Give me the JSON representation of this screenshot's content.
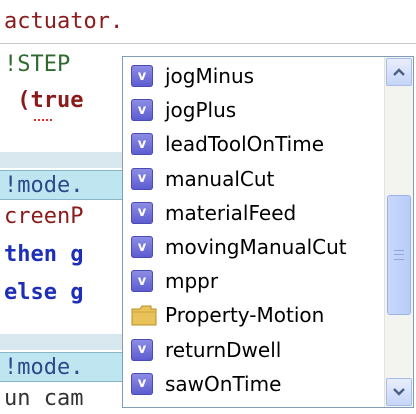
{
  "editor": {
    "lines": [
      "actuator.",
      "!STEP",
      " (true",
      "!mode.",
      "creenP",
      "then g",
      "else g",
      "!mode.",
      "un cam"
    ]
  },
  "autocomplete": {
    "items": [
      {
        "label": "jogMinus",
        "icon": "variable-icon",
        "badge": "v"
      },
      {
        "label": "jogPlus",
        "icon": "variable-icon",
        "badge": "v"
      },
      {
        "label": "leadToolOnTime",
        "icon": "variable-icon",
        "badge": "v"
      },
      {
        "label": "manualCut",
        "icon": "variable-icon",
        "badge": "v"
      },
      {
        "label": "materialFeed",
        "icon": "variable-icon",
        "badge": "v"
      },
      {
        "label": "movingManualCut",
        "icon": "variable-icon",
        "badge": "v"
      },
      {
        "label": "mppr",
        "icon": "variable-icon",
        "badge": "v"
      },
      {
        "label": "Property-Motion",
        "icon": "folder-icon",
        "badge": ""
      },
      {
        "label": "returnDwell",
        "icon": "variable-icon",
        "badge": "v"
      },
      {
        "label": "sawOnTime",
        "icon": "variable-icon",
        "badge": "v"
      }
    ]
  },
  "colors": {
    "badge": "#6b6bd9",
    "highlight_line": "#bfe6f0",
    "keyword_blue": "#1d2fb8",
    "code_red": "#8b1a1a"
  }
}
